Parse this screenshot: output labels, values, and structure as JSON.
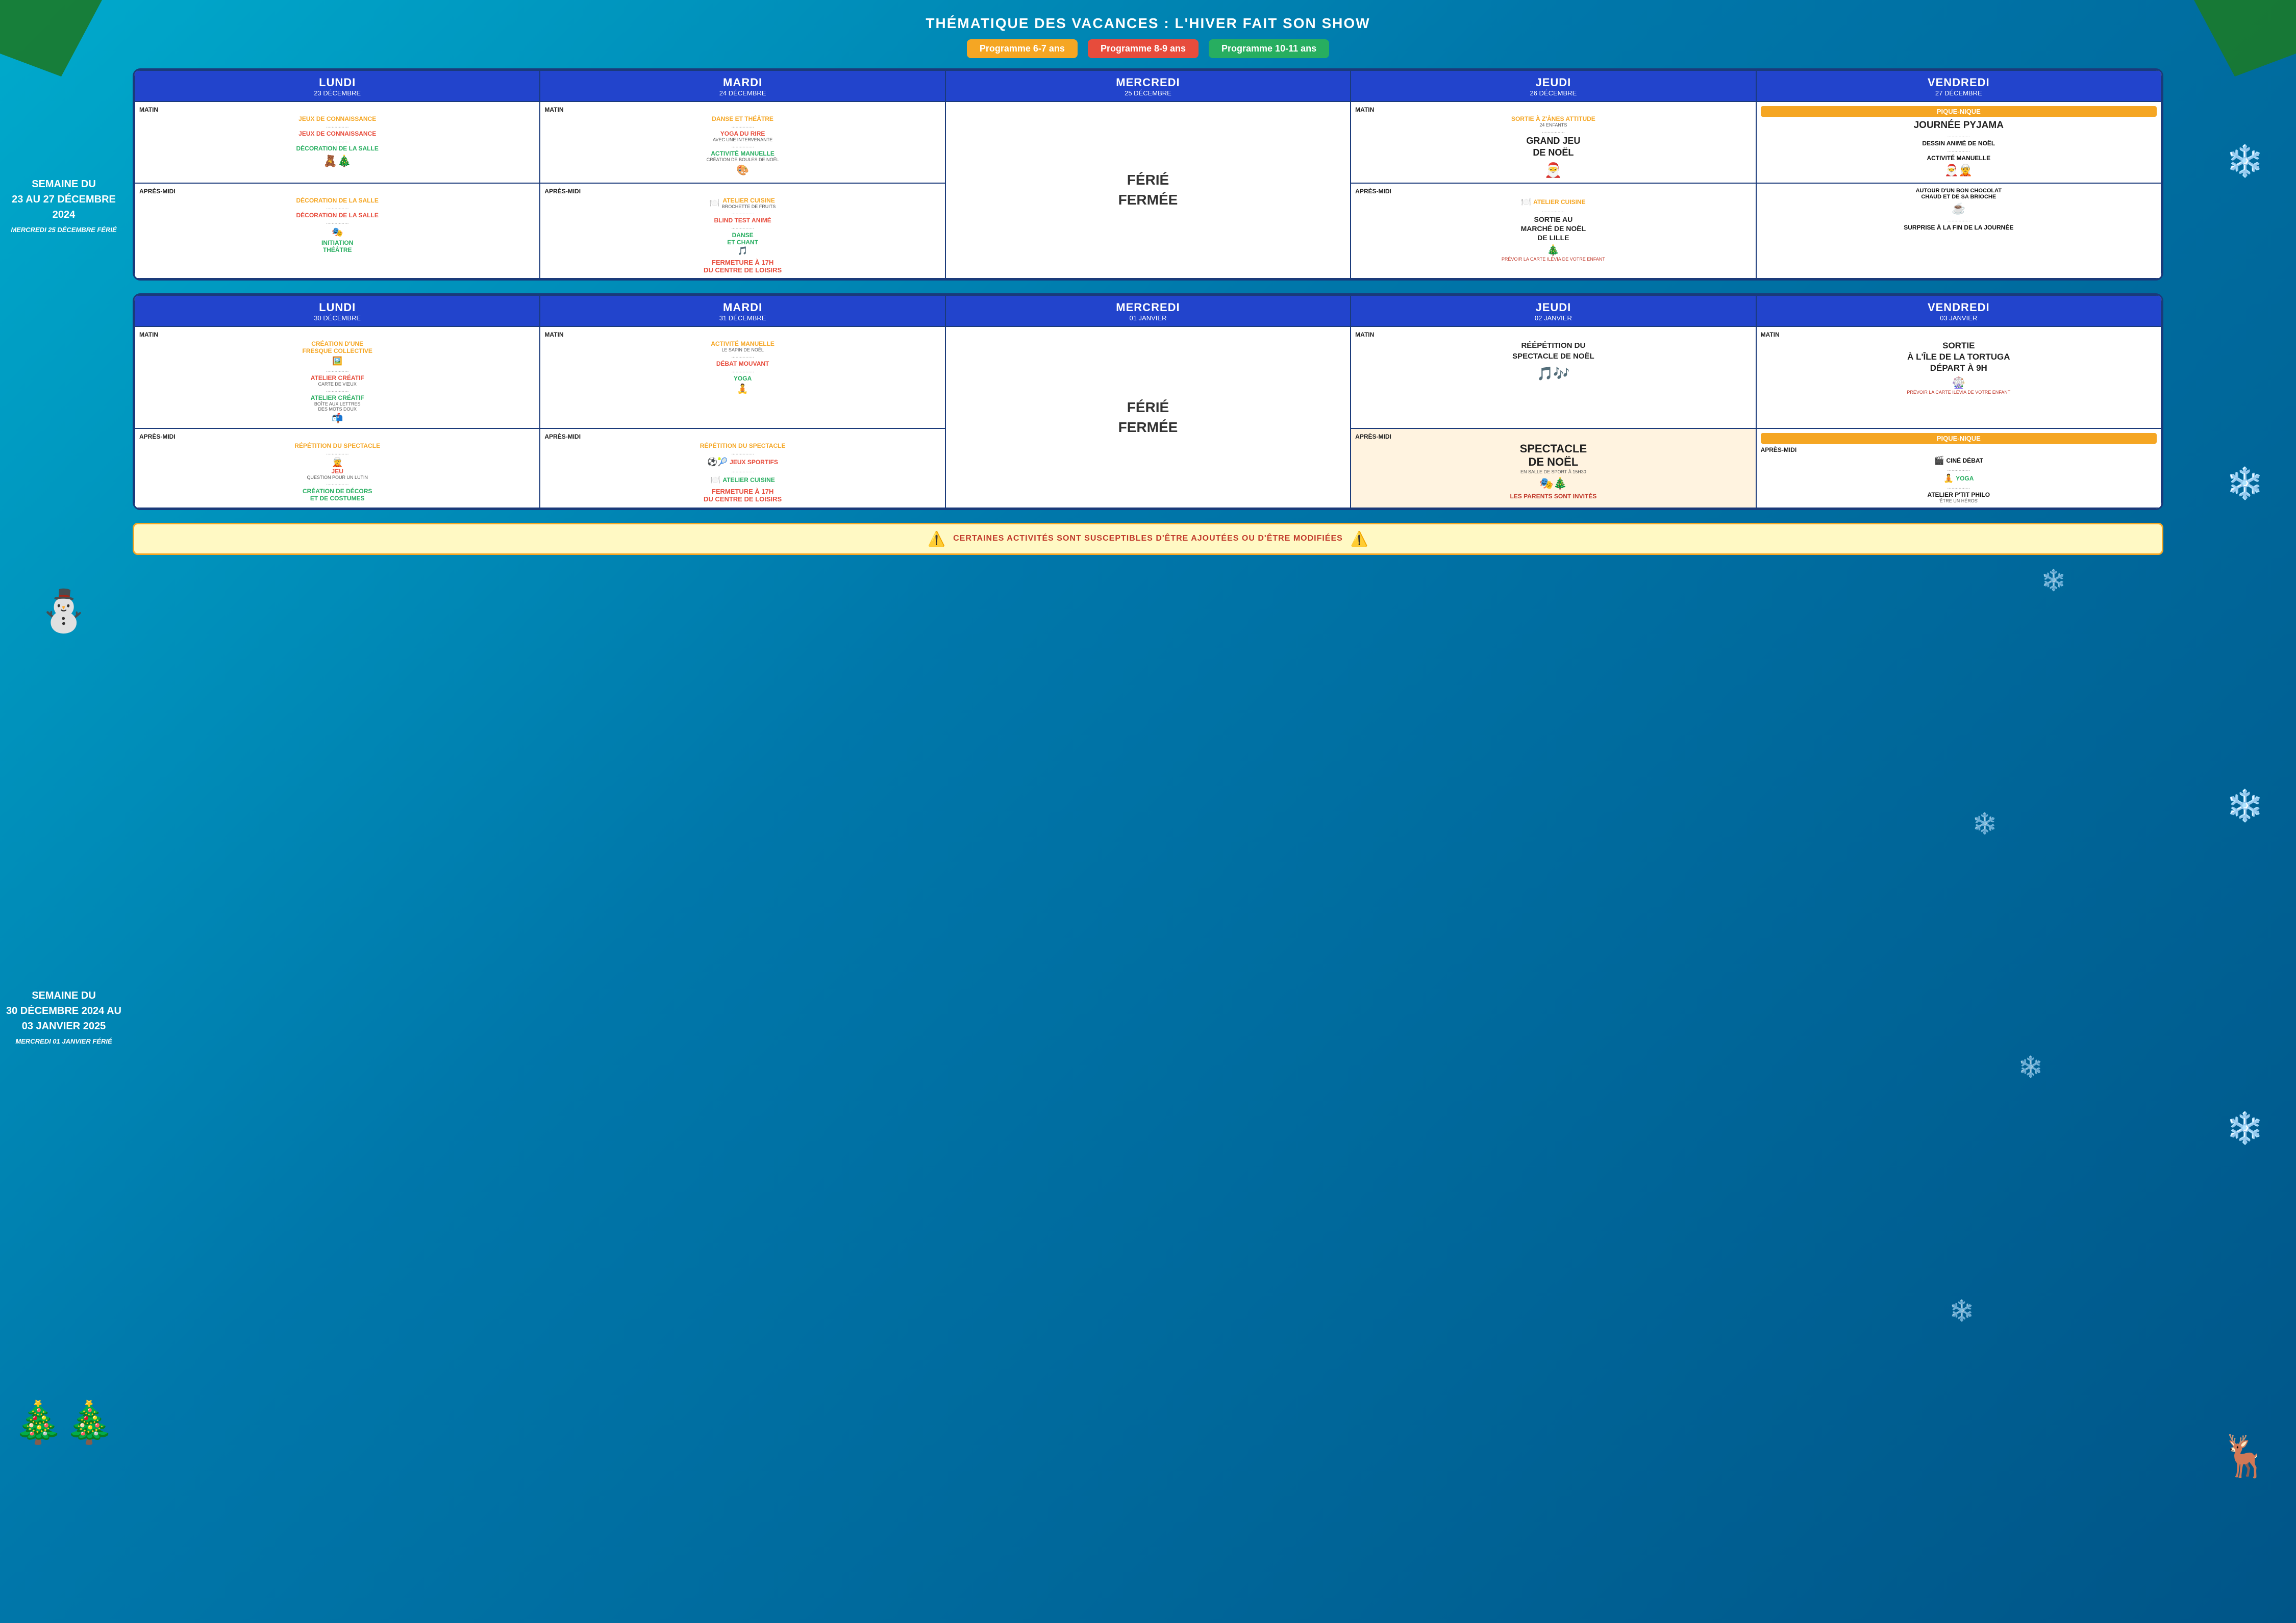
{
  "page": {
    "title": "THÉMATIQUE DES VACANCES : L'HIVER FAIT SON SHOW",
    "badges": [
      {
        "label": "Programme 6-7 ans",
        "color": "orange"
      },
      {
        "label": "Programme 8-9 ans",
        "color": "red"
      },
      {
        "label": "Programme 10-11 ans",
        "color": "green"
      }
    ]
  },
  "week1": {
    "title": "SEMAINE DU\n23 AU 27 DÉCEMBRE 2024",
    "ferie": "MERCREDI 25 DÉCEMBRE FÉRIÉ",
    "days": [
      {
        "name": "LUNDI",
        "date": "23 DÉCEMBRE",
        "matin": {
          "label": "MATIN",
          "activities": [
            {
              "text": "JEUX DE CONNAISSANCE",
              "color": "orange"
            },
            {
              "text": "JEUX DE CONNAISSANCE",
              "color": "red"
            },
            {
              "text": "DÉCORATION DE LA SALLE",
              "color": "green"
            }
          ]
        },
        "apres_midi": {
          "label": "APRÈS-MIDI",
          "activities": [
            {
              "text": "DÉCORATION DE LA SALLE",
              "color": "orange"
            },
            {
              "text": "DÉCORATION DE LA SALLE",
              "color": "red"
            },
            {
              "text": "INITIATION THÉÂTRE",
              "color": "green"
            }
          ]
        }
      },
      {
        "name": "MARDI",
        "date": "24 DÉCEMBRE",
        "matin": {
          "label": "MATIN",
          "activities": [
            {
              "text": "DANSE ET THÉÂTRE",
              "color": "orange"
            },
            {
              "text": "YOGA DU RIRE\nAVEC UNE INTERVENANTE",
              "color": "red"
            },
            {
              "text": "ACTIVITÉ MANUELLE\nCRÉATION DE BOULES DE NOËL",
              "color": "green"
            }
          ]
        },
        "apres_midi": {
          "label": "APRÈS-MIDI",
          "activities": [
            {
              "text": "ATELIER CUISINE\nBROCHETTE DE FRUITS",
              "color": "orange"
            },
            {
              "text": "BLIND TEST ANIMÉ",
              "color": "red"
            },
            {
              "text": "DANSE ET CHANT",
              "color": "green"
            }
          ],
          "closing": "FERMETURE À 17H\nDU CENTRE DE LOISIRS"
        }
      },
      {
        "name": "MERCREDI",
        "date": "25 DÉCEMBRE",
        "ferie": true
      },
      {
        "name": "JEUDI",
        "date": "26 DÉCEMBRE",
        "matin": {
          "label": "MATIN",
          "activities": [
            {
              "text": "SORTIE À Z'ÂNES ATTITUDE\n24 ENFANTS",
              "color": "orange"
            },
            {
              "text": "GRAND JEU\nDE NOËL",
              "color": "black"
            }
          ]
        },
        "apres_midi": {
          "label": "APRÈS-MIDI",
          "activities": [
            {
              "text": "ATELIER CUISINE",
              "color": "orange"
            },
            {
              "text": "SORTIE AU\nMARCHÉ DE NOËL\nDE LILLE",
              "color": "red"
            }
          ],
          "note": "PRÉVOIR LA CARTE ILÉVIA DE VOTRE ENFANT"
        }
      },
      {
        "name": "VENDREDI",
        "date": "27 DÉCEMBRE",
        "pique_nique": true,
        "matin": {
          "label": "",
          "activities": [
            {
              "text": "JOURNÉE PYJAMA",
              "color": "black"
            },
            {
              "text": "DESSIN ANIMÉ DE NOËL",
              "color": "black"
            },
            {
              "text": "ACTIVITÉ MANUELLE",
              "color": "black"
            }
          ]
        },
        "apres_midi": {
          "label": "",
          "activities": [
            {
              "text": "AUTOUR D'UN BON CHOCOLAT\nCHAUD ET DE SA BRIOCHE",
              "color": "black"
            },
            {
              "text": "SURPRISE À LA FIN DE LA JOURNÉE",
              "color": "black"
            }
          ]
        }
      }
    ]
  },
  "week2": {
    "title": "SEMAINE DU\n30 DÉCEMBRE 2024 AU\n03 JANVIER 2025",
    "ferie": "MERCREDI 01 JANVIER FÉRIÉ",
    "days": [
      {
        "name": "LUNDI",
        "date": "30 DÉCEMBRE",
        "matin": {
          "label": "MATIN",
          "activities": [
            {
              "text": "CRÉATION D'UNE\nFRESQUE COLLECTIVE",
              "color": "orange"
            },
            {
              "text": "ATELIER CRÉATIF\nCARTE DE VŒUX",
              "color": "red"
            },
            {
              "text": "ATELIER CRÉATIF\nBOÎTE AUX LETTRES\nDES MOTS DOUX",
              "color": "green"
            }
          ]
        },
        "apres_midi": {
          "label": "APRÈS-MIDI",
          "activities": [
            {
              "text": "RÉPÉTITION DU SPECTACLE",
              "color": "orange"
            },
            {
              "text": "JEU\nQUESTION POUR UN LUTIN",
              "color": "red"
            },
            {
              "text": "CRÉATION DE DÉCORS\nET DE COSTUMES",
              "color": "green"
            }
          ]
        }
      },
      {
        "name": "MARDI",
        "date": "31 DÉCEMBRE",
        "matin": {
          "label": "MATIN",
          "activities": [
            {
              "text": "ACTIVITÉ MANUELLE\nLE SAPIN DE NOËL",
              "color": "orange"
            },
            {
              "text": "DÉBAT MOUVANT",
              "color": "red"
            },
            {
              "text": "YOGA",
              "color": "green"
            }
          ]
        },
        "apres_midi": {
          "label": "APRÈS-MIDI",
          "activities": [
            {
              "text": "RÉPÉTITION DU SPECTACLE",
              "color": "orange"
            },
            {
              "text": "JEUX SPORTIFS",
              "color": "red"
            },
            {
              "text": "ATELIER CUISINE",
              "color": "green"
            }
          ],
          "closing": "FERMETURE À 17H\nDU CENTRE DE LOISIRS"
        }
      },
      {
        "name": "MERCREDI",
        "date": "01 JANVIER",
        "ferie": true
      },
      {
        "name": "JEUDI",
        "date": "02 JANVIER",
        "matin": {
          "label": "MATIN",
          "activities": [
            {
              "text": "RÉÉPÉTITION DU\nSPECTACLE DE NOËL",
              "color": "black"
            }
          ]
        },
        "apres_midi": {
          "label": "APRÈS-MIDI",
          "activities": [
            {
              "text": "SPECTACLE\nDE NOËL",
              "color": "black",
              "big": true
            },
            {
              "text": "EN SALLE DE SPORT À 15H30",
              "color": "black"
            },
            {
              "text": "LES PARENTS SONT INVITÉS",
              "color": "black"
            }
          ]
        }
      },
      {
        "name": "VENDREDI",
        "date": "03 JANVIER",
        "pique_nique": true,
        "matin": {
          "label": "MATIN",
          "activities": [
            {
              "text": "SORTIE\nÀ L'ÎLE DE LA TORTUGA\nDÉPART À 9H",
              "color": "black"
            }
          ],
          "note": "PRÉVOIR LA CARTE ILÉVIA DE VOTRE ENFANT"
        },
        "apres_midi": {
          "label": "APRÈS-MIDI",
          "activities": [
            {
              "text": "CINÉ DÉBAT",
              "color": "black"
            },
            {
              "text": "YOGA",
              "color": "green"
            },
            {
              "text": "ATELIER P'TIT PHILO\n'ÊTRE UN HÉROS'",
              "color": "black"
            }
          ]
        }
      }
    ]
  },
  "warning": {
    "text": "CERTAINES ACTIVITÉS SONT SUSCEPTIBLES D'ÊTRE AJOUTÉES OU D'ÊTRE MODIFIÉES"
  },
  "icons": {
    "warning": "⚠️",
    "snowman": "⛄",
    "tree": "🎄",
    "reindeer": "🦌",
    "snowflake": "❄️"
  }
}
